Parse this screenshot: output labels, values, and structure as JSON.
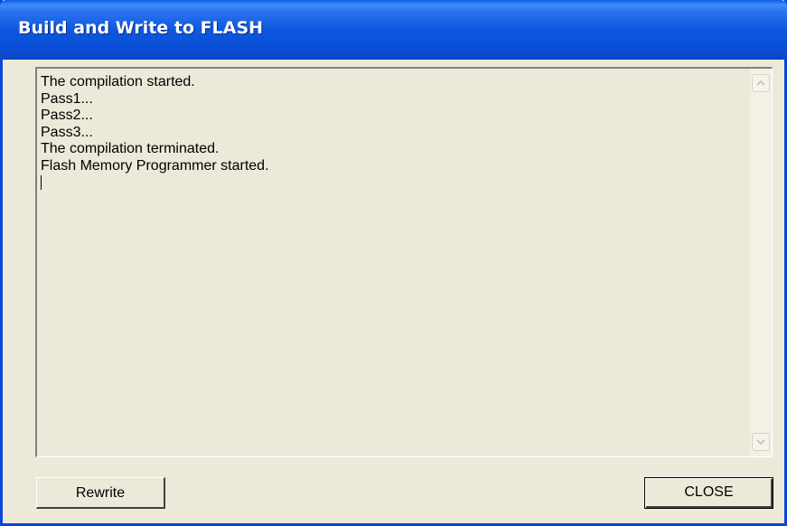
{
  "window": {
    "title": "Build and Write to FLASH"
  },
  "log": {
    "lines": [
      "The compilation started.",
      "Pass1...",
      "Pass2...",
      "Pass3...",
      "The compilation terminated.",
      "Flash Memory Programmer started."
    ]
  },
  "buttons": {
    "rewrite_label": "Rewrite",
    "close_label": "CLOSE"
  },
  "colors": {
    "titlebar": "#0a4fd6",
    "dialog_face": "#ece9d8"
  }
}
